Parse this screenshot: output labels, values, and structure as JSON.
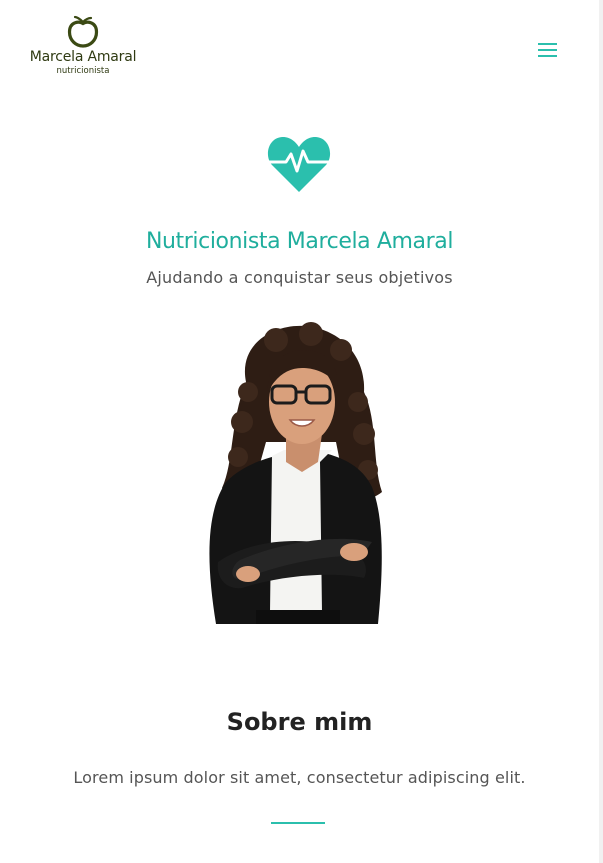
{
  "header": {
    "logo_name": "Marcela Amaral",
    "logo_subtitle": "nutricionista",
    "logo_icon": "apple-outline-icon",
    "menu_icon": "hamburger-menu-icon"
  },
  "hero": {
    "icon": "heart-pulse-icon",
    "title": "Nutricionista Marcela Amaral",
    "subtitle": "Ajudando a conquistar seus objetivos",
    "image": "nutritionist-portrait"
  },
  "about": {
    "heading": "Sobre mim",
    "text": "Lorem ipsum dolor sit amet, consectetur adipiscing elit."
  },
  "colors": {
    "accent": "#2bbfad",
    "title_teal": "#1fae9d",
    "logo_olive": "#2f3a12",
    "body_text": "#555555",
    "heading_text": "#222222"
  }
}
